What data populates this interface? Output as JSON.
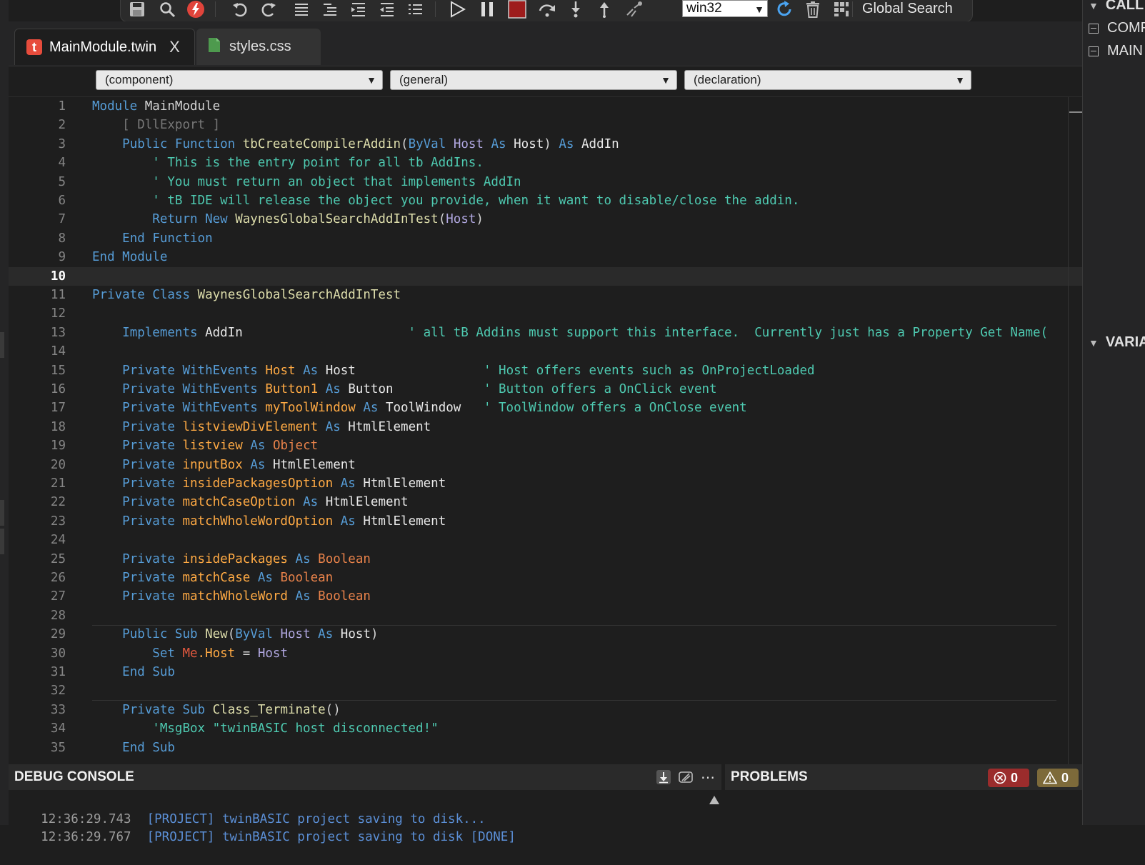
{
  "toolbar": {
    "target_value": "win32",
    "global_search_label": "Global Search"
  },
  "tabs": [
    {
      "label": "MainModule.twin",
      "logo": "t",
      "close": "X"
    },
    {
      "label": "styles.css"
    }
  ],
  "dropdowns": {
    "component": "(component)",
    "general": "(general)",
    "declaration": "(declaration)"
  },
  "editor": {
    "active_line": 10,
    "line_numbers": [
      "1",
      "2",
      "3",
      "4",
      "5",
      "6",
      "7",
      "8",
      "9",
      "10",
      "11",
      "12",
      "13",
      "14",
      "15",
      "16",
      "17",
      "18",
      "19",
      "20",
      "21",
      "22",
      "23",
      "24",
      "25",
      "26",
      "27",
      "28",
      "29",
      "30",
      "31",
      "32",
      "33",
      "34",
      "35"
    ],
    "code": {
      "l1a": "Module",
      "l1b": "MainModule",
      "l2": "[ DllExport ]",
      "l3a": "Public",
      "l3b": "Function",
      "l3c": "tbCreateCompilerAddin",
      "l3d": "(",
      "l3e": "ByVal",
      "l3f": "Host",
      "l3g": "As",
      "l3h": "Host",
      "l3i": ")",
      "l3j": "As",
      "l3k": "AddIn",
      "l4": "' This is the entry point for all tb AddIns.",
      "l5": "' You must return an object that implements AddIn",
      "l6": "' tB IDE will release the object you provide, when it want to disable/close the addin.",
      "l7a": "Return",
      "l7b": "New",
      "l7c": "WaynesGlobalSearchAddInTest",
      "l7d": "(",
      "l7e": "Host",
      "l7f": ")",
      "l8a": "End",
      "l8b": "Function",
      "l9a": "End",
      "l9b": "Module",
      "l11a": "Private",
      "l11b": "Class",
      "l11c": "WaynesGlobalSearchAddInTest",
      "l13a": "Implements",
      "l13b": "AddIn",
      "l13c": "' all tB Addins must support this interface.  Currently just has a Property Get Name(",
      "l15a": "Private",
      "l15b": "WithEvents",
      "l15c": "Host",
      "l15d": "As",
      "l15e": "Host",
      "l15f": "' Host offers events such as OnProjectLoaded",
      "l16a": "Private",
      "l16b": "WithEvents",
      "l16c": "Button1",
      "l16d": "As",
      "l16e": "Button",
      "l16f": "' Button offers a OnClick event",
      "l17a": "Private",
      "l17b": "WithEvents",
      "l17c": "myToolWindow",
      "l17d": "As",
      "l17e": "ToolWindow",
      "l17f": "' ToolWindow offers a OnClose event",
      "l18a": "Private",
      "l18b": "listviewDivElement",
      "l18c": "As",
      "l18d": "HtmlElement",
      "l19a": "Private",
      "l19b": "listview",
      "l19c": "As",
      "l19d": "Object",
      "l20a": "Private",
      "l20b": "inputBox",
      "l20c": "As",
      "l20d": "HtmlElement",
      "l21a": "Private",
      "l21b": "insidePackagesOption",
      "l21c": "As",
      "l21d": "HtmlElement",
      "l22a": "Private",
      "l22b": "matchCaseOption",
      "l22c": "As",
      "l22d": "HtmlElement",
      "l23a": "Private",
      "l23b": "matchWholeWordOption",
      "l23c": "As",
      "l23d": "HtmlElement",
      "l25a": "Private",
      "l25b": "insidePackages",
      "l25c": "As",
      "l25d": "Boolean",
      "l26a": "Private",
      "l26b": "matchCase",
      "l26c": "As",
      "l26d": "Boolean",
      "l27a": "Private",
      "l27b": "matchWholeWord",
      "l27c": "As",
      "l27d": "Boolean",
      "l29a": "Public",
      "l29b": "Sub",
      "l29c": "New",
      "l29d": "(",
      "l29e": "ByVal",
      "l29f": "Host",
      "l29g": "As",
      "l29h": "Host",
      "l29i": ")",
      "l30a": "Set",
      "l30b": "Me",
      "l30c": ".Host",
      "l30d": "=",
      "l30e": "Host",
      "l31a": "End",
      "l31b": "Sub",
      "l33a": "Private",
      "l33b": "Sub",
      "l33c": "Class_Terminate",
      "l33d": "()",
      "l34": "'MsgBox \"twinBASIC host disconnected!\"",
      "l35a": "End",
      "l35b": "Sub"
    }
  },
  "right_panel": {
    "call_label": "CALL",
    "comp_label": "COMP",
    "main_label": "MAIN",
    "vari_label": "VARIA"
  },
  "debug_console": {
    "title": "DEBUG CONSOLE",
    "logs": [
      {
        "time": "12:36:29.743",
        "message": "[PROJECT] twinBASIC project saving to disk..."
      },
      {
        "time": "12:36:29.767",
        "message": "[PROJECT] twinBASIC project saving to disk [DONE]"
      }
    ]
  },
  "problems": {
    "title": "PROBLEMS",
    "errors": "0",
    "warnings": "0"
  },
  "colors": {
    "background": "#1e1e1e",
    "keyword": "#569cd6",
    "function": "#dcdcaa",
    "comment": "#4ec9b0",
    "identifier": "#ffaa44",
    "error_badge": "#9b2c2c",
    "warning_badge": "#7d6a3a"
  }
}
